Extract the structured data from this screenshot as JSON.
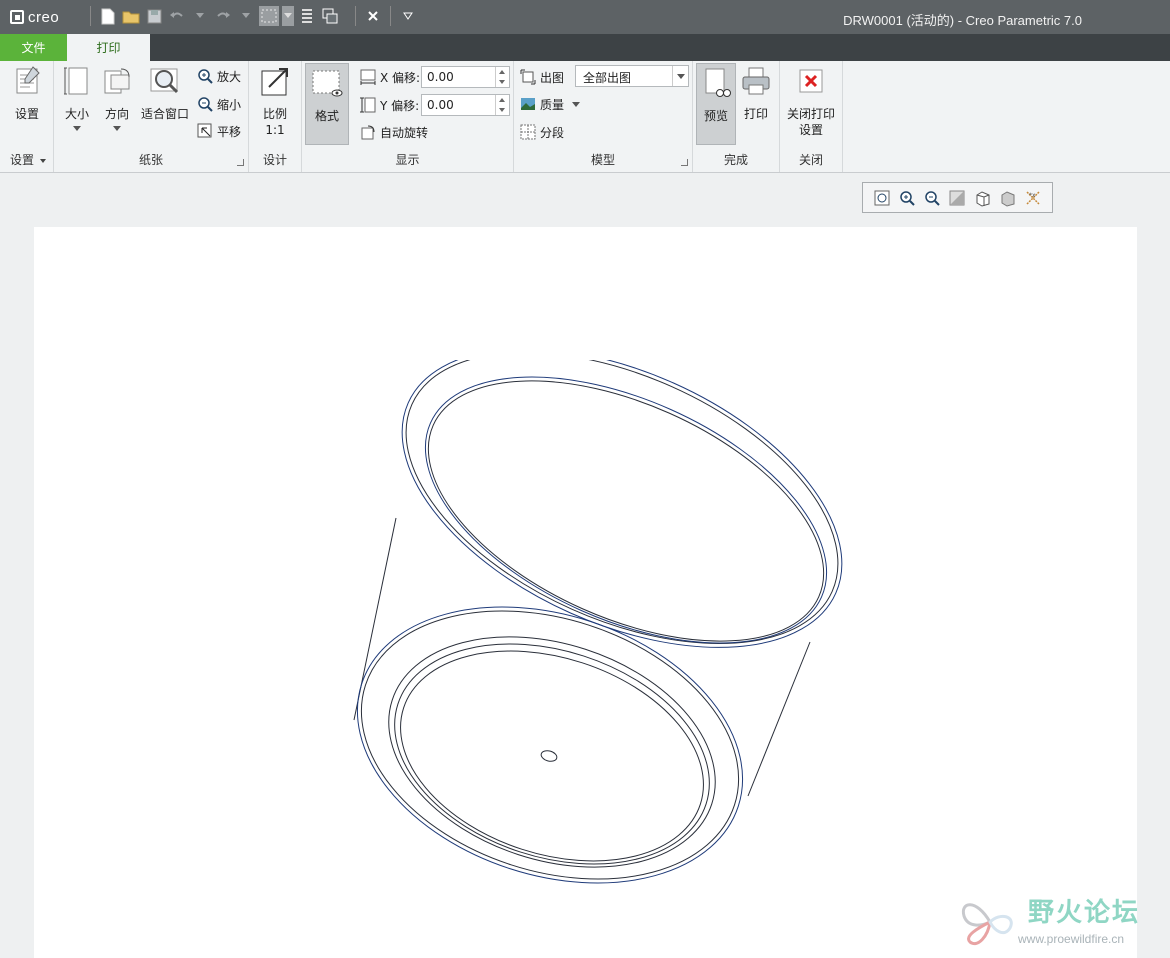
{
  "app": {
    "logo_text": "creo",
    "window_title": "DRW0001 (活动的) - Creo Parametric 7.0"
  },
  "tabs": [
    {
      "label": "文件"
    },
    {
      "label": "打印"
    }
  ],
  "ribbon": {
    "groups": {
      "settings": {
        "label": "设置",
        "button": "设置"
      },
      "paper": {
        "label": "纸张",
        "size": "大小",
        "orientation": "方向",
        "fit": "适合窗口",
        "zoom_in": "放大",
        "zoom_out": "缩小",
        "pan": "平移"
      },
      "design": {
        "label": "设计",
        "scale_line1": "比例",
        "scale_line2": "1:1"
      },
      "display": {
        "label": "显示",
        "format": "格式",
        "x_offset_label": "X 偏移:",
        "x_offset_value": "0.00",
        "y_offset_label": "Y 偏移:",
        "y_offset_value": "0.00",
        "auto_rotate": "自动旋转"
      },
      "model": {
        "label": "模型",
        "plot": "出图",
        "plot_option": "全部出图",
        "quality": "质量",
        "segment": "分段"
      },
      "finish": {
        "label": "完成",
        "preview": "预览",
        "print": "打印"
      },
      "close": {
        "label": "关闭",
        "close_line1": "关闭打印",
        "close_line2": "设置"
      }
    }
  },
  "watermark": {
    "title": "野火论坛",
    "url": "www.proewildfire.cn"
  },
  "colors": {
    "titlebar": "#5d6265",
    "tab_file": "#5bb33a",
    "ribbon_bg": "#f1f3f4",
    "model_edge": "#1f3b7a"
  }
}
